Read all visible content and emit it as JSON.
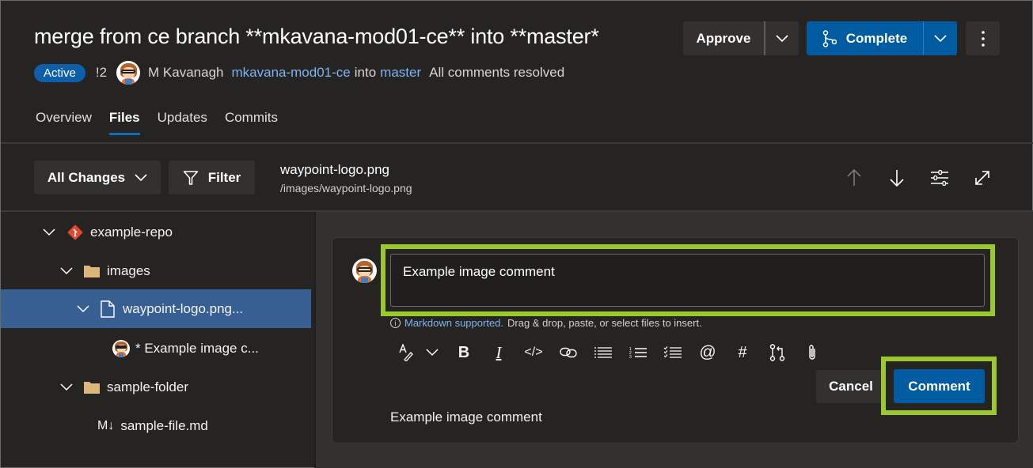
{
  "header": {
    "title": "merge from ce branch **mkavana-mod01-ce** into **master*",
    "status_badge": "Active",
    "pr_id": "!2",
    "author": "M Kavanagh",
    "source_branch": "mkavana-mod01-ce",
    "into_label": "into",
    "target_branch": "master",
    "comments_status": "All comments resolved"
  },
  "actions": {
    "approve_label": "Approve",
    "complete_label": "Complete",
    "complete_color": "#005ba1"
  },
  "tabs": [
    {
      "label": "Overview",
      "active": false
    },
    {
      "label": "Files",
      "active": true
    },
    {
      "label": "Updates",
      "active": false
    },
    {
      "label": "Commits",
      "active": false
    }
  ],
  "toolbar": {
    "all_changes_label": "All Changes",
    "filter_label": "Filter",
    "file_name": "waypoint-logo.png",
    "file_path": "/images/waypoint-logo.png"
  },
  "tree": {
    "items": [
      {
        "label": "example-repo",
        "type": "repo",
        "expanded": true
      },
      {
        "label": "images",
        "type": "folder",
        "expanded": true
      },
      {
        "label": "waypoint-logo.png...",
        "type": "file",
        "expanded": true,
        "selected": true
      },
      {
        "label": "* Example image c...",
        "type": "comment"
      },
      {
        "label": "sample-folder",
        "type": "folder",
        "expanded": true
      },
      {
        "label": "sample-file.md",
        "type": "markdown",
        "icon_text": "M↓"
      }
    ]
  },
  "comment": {
    "input_value": "Example image comment",
    "hint_link": "Markdown supported.",
    "hint_text": "Drag & drop, paste, or select files to insert.",
    "formatting": [
      "format-text",
      "format-dropdown",
      "bold",
      "italic",
      "code",
      "link",
      "bulleted-list",
      "numbered-list",
      "task-list",
      "mention",
      "work-item",
      "pull-request",
      "attach"
    ],
    "cancel_label": "Cancel",
    "submit_label": "Comment",
    "preview": "Example image comment",
    "highlight_color": "#9bc92b"
  }
}
